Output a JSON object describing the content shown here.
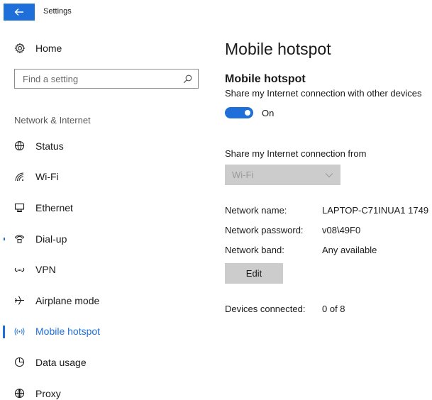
{
  "window": {
    "title": "Settings"
  },
  "sidebar": {
    "home_label": "Home",
    "search_placeholder": "Find a setting",
    "section_label": "Network & Internet",
    "items": [
      {
        "label": "Status",
        "icon": "globe-icon"
      },
      {
        "label": "Wi-Fi",
        "icon": "wifi-icon"
      },
      {
        "label": "Ethernet",
        "icon": "ethernet-icon"
      },
      {
        "label": "Dial-up",
        "icon": "phone-icon"
      },
      {
        "label": "VPN",
        "icon": "vpn-icon"
      },
      {
        "label": "Airplane mode",
        "icon": "airplane-icon"
      },
      {
        "label": "Mobile hotspot",
        "icon": "hotspot-icon",
        "active": true
      },
      {
        "label": "Data usage",
        "icon": "data-usage-icon"
      },
      {
        "label": "Proxy",
        "icon": "globe-icon"
      }
    ]
  },
  "main": {
    "page_title": "Mobile hotspot",
    "section_title": "Mobile hotspot",
    "share_description": "Share my Internet connection with other devices",
    "toggle_label": "On",
    "share_from_label": "Share my Internet connection from",
    "share_from_value": "Wi-Fi",
    "network_name_label": "Network name:",
    "network_name_value": "LAPTOP-C71INUA1 1749",
    "network_password_label": "Network password:",
    "network_password_value": "v08\\49F0",
    "network_band_label": "Network band:",
    "network_band_value": "Any available",
    "edit_label": "Edit",
    "devices_connected_label": "Devices connected:",
    "devices_connected_value": "0 of 8"
  },
  "colors": {
    "accent": "#1e6fd9",
    "disabled_bg": "#cccccc"
  }
}
